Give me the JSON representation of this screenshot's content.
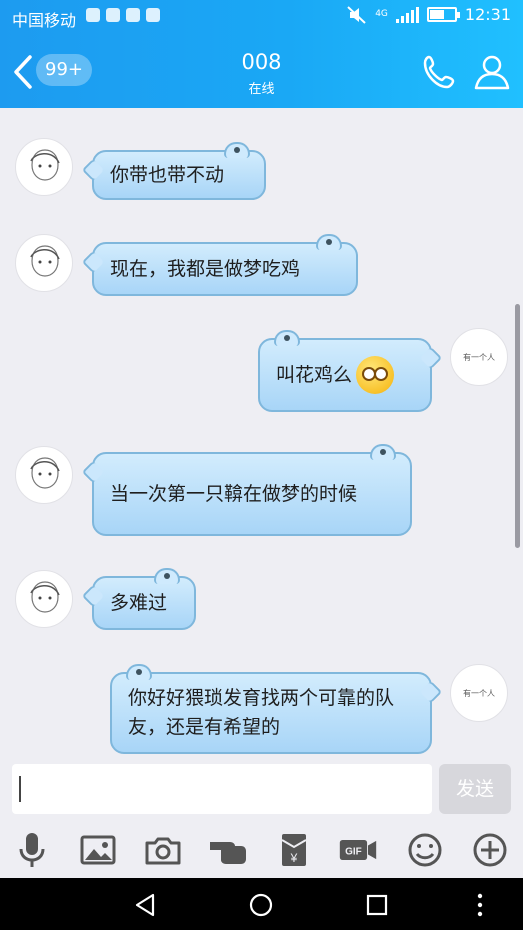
{
  "status": {
    "carrier": "中国移动",
    "network": "4G",
    "time": "12:31"
  },
  "header": {
    "badge": "99+",
    "title": "008",
    "subtitle": "在线"
  },
  "messages": [
    {
      "side": "left",
      "text": "你带也带不动"
    },
    {
      "side": "left",
      "text": "现在，我都是做梦吃鸡"
    },
    {
      "side": "right",
      "text": "叫花鸡么",
      "emoji": "dazed-face-emoji"
    },
    {
      "side": "left",
      "text": "当一次第一只鞥在做梦的时候"
    },
    {
      "side": "left",
      "text": "多难过"
    },
    {
      "side": "right",
      "text": "你好好猥琐发育找两个可靠的队友，还是有希望的"
    }
  ],
  "me_avatar_text": "有一个人",
  "input": {
    "value": "",
    "send_label": "发送"
  },
  "toolbar": {
    "icons": [
      "microphone-icon",
      "image-icon",
      "camera-icon",
      "poke-hand-icon",
      "red-envelope-icon",
      "gif-icon",
      "emoji-icon",
      "plus-icon"
    ],
    "gif_label": "GIF",
    "yuan_label": "¥"
  },
  "colors": {
    "header_start": "#1d9bf0",
    "header_end": "#20c0ff",
    "bubble": "#b9def9",
    "bubble_border": "#7fb7dc",
    "background": "#eeeef3"
  }
}
